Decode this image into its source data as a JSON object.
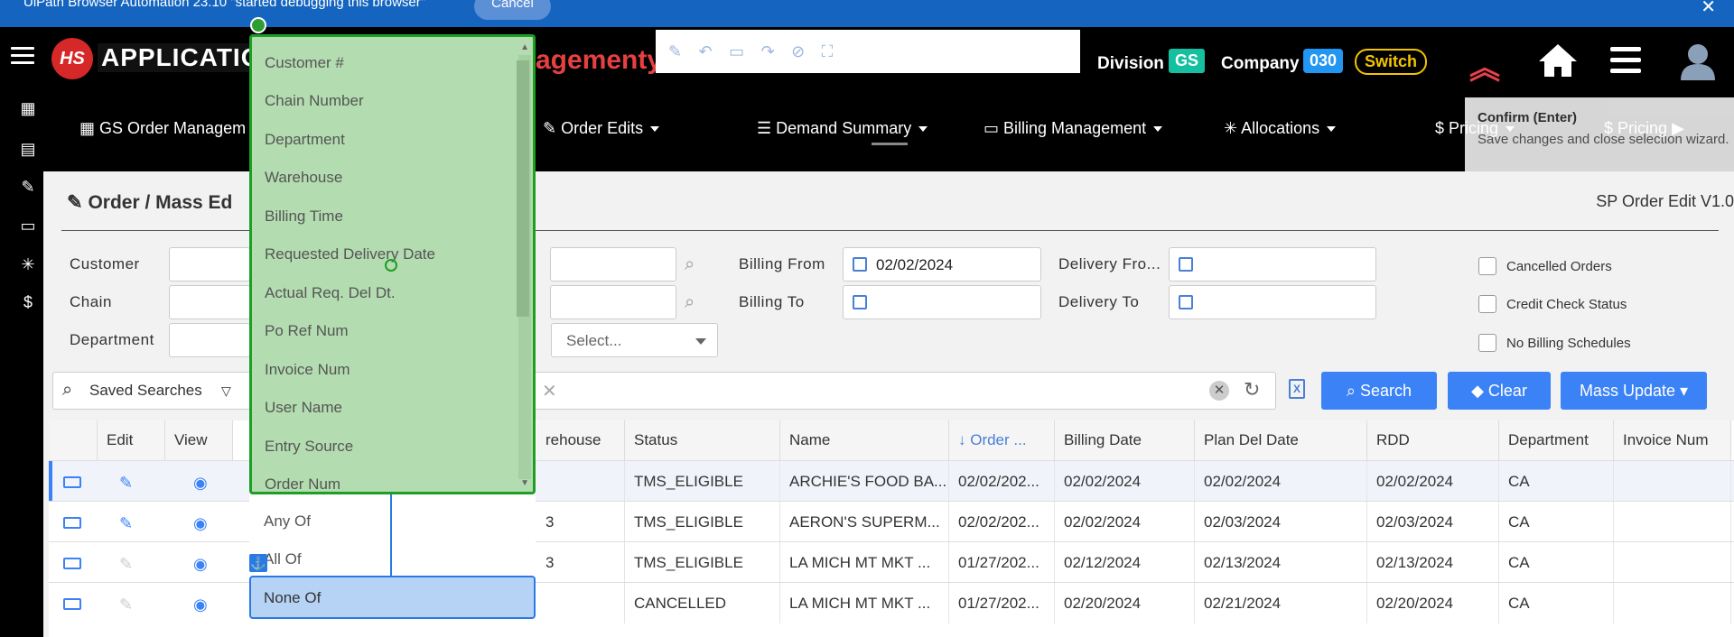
{
  "debug_bar": {
    "message": "UiPath Browser Automation 23.10 \"started debugging this browser\"",
    "cancel_label": "Cancel",
    "close_glyph": "✕"
  },
  "header": {
    "logo_initials": "HS",
    "logo_text": "APPLICATION",
    "app_title": "agement",
    "app_title_suffix": "y",
    "division_label": "Division",
    "division_value": "GS",
    "company_label": "Company",
    "company_value": "030",
    "switch_label": "Switch",
    "tooltip_title": "Confirm (Enter)",
    "tooltip_text": "Save changes and close selection wizard."
  },
  "nav": {
    "items": [
      {
        "label": "GS Order Managem",
        "icon": "grid-icon"
      },
      {
        "label": "Order Edits",
        "icon": "edit-icon"
      },
      {
        "label": "Demand Summary",
        "icon": "list-icon"
      },
      {
        "label": "Billing Management",
        "icon": "card-icon"
      },
      {
        "label": "Allocations",
        "icon": "asterisk-icon"
      },
      {
        "label": "Pricing",
        "icon": "dollar-icon"
      },
      {
        "label": "Pricing",
        "icon": "dollar-icon"
      }
    ]
  },
  "page": {
    "title": "Order / Mass Ed",
    "version": "SP Order Edit V1.0"
  },
  "filters": {
    "customer_label": "Customer",
    "chain_label": "Chain",
    "department_label": "Department",
    "select_placeholder": "Select...",
    "billing_from_label": "Billing From",
    "billing_from_value": "02/02/2024",
    "billing_to_label": "Billing To",
    "delivery_from_label": "Delivery Fro...",
    "delivery_to_label": "Delivery To",
    "cancelled_orders_label": "Cancelled Orders",
    "credit_check_label": "Credit Check Status",
    "no_billing_label": "No Billing Schedules"
  },
  "saved_searches": {
    "label": "Saved Searches"
  },
  "buttons": {
    "search": "Search",
    "clear": "Clear",
    "mass_update": "Mass Update"
  },
  "table": {
    "columns": [
      "Edit",
      "View",
      "rehouse",
      "Status",
      "Name",
      "↓ Order ...",
      "Billing Date",
      "Plan Del Date",
      "RDD",
      "Department",
      "Invoice Num"
    ],
    "rows": [
      {
        "digit": "",
        "status": "TMS_ELIGIBLE",
        "name": "ARCHIE'S FOOD BA...",
        "order": "02/02/202...",
        "billing": "02/02/2024",
        "plan": "02/02/2024",
        "rdd": "02/02/2024",
        "dept": "CA",
        "invoice": ""
      },
      {
        "digit": "3",
        "status": "TMS_ELIGIBLE",
        "name": "AERON'S SUPERM...",
        "order": "02/02/202...",
        "billing": "02/02/2024",
        "plan": "02/03/2024",
        "rdd": "02/03/2024",
        "dept": "CA",
        "invoice": ""
      },
      {
        "digit": "3",
        "status": "TMS_ELIGIBLE",
        "name": "LA MICH MT MKT ...",
        "order": "01/27/202...",
        "billing": "02/12/2024",
        "plan": "02/13/2024",
        "rdd": "02/13/2024",
        "dept": "CA",
        "invoice": ""
      },
      {
        "digit": "",
        "status": "CANCELLED",
        "name": "LA MICH MT MKT ...",
        "order": "01/27/202...",
        "billing": "02/20/2024",
        "plan": "02/21/2024",
        "rdd": "02/20/2024",
        "dept": "CA",
        "invoice": ""
      }
    ]
  },
  "field_dropdown": {
    "items": [
      "Customer #",
      "Chain Number",
      "Department",
      "Warehouse",
      "Billing Time",
      "Requested Delivery Date",
      "Actual Req. Del Dt.",
      "Po Ref Num",
      "Invoice Num",
      "User Name",
      "Entry Source",
      "Order Num"
    ]
  },
  "operator_dropdown": {
    "items": [
      "Any Of",
      "All Of"
    ],
    "selected": "None Of"
  },
  "colors": {
    "debug_bar": "#1565c0",
    "popup_bg": "#b3dcb0",
    "popup_border": "#1e9e24",
    "primary": "#3b82f6",
    "title_red": "#e64040"
  }
}
